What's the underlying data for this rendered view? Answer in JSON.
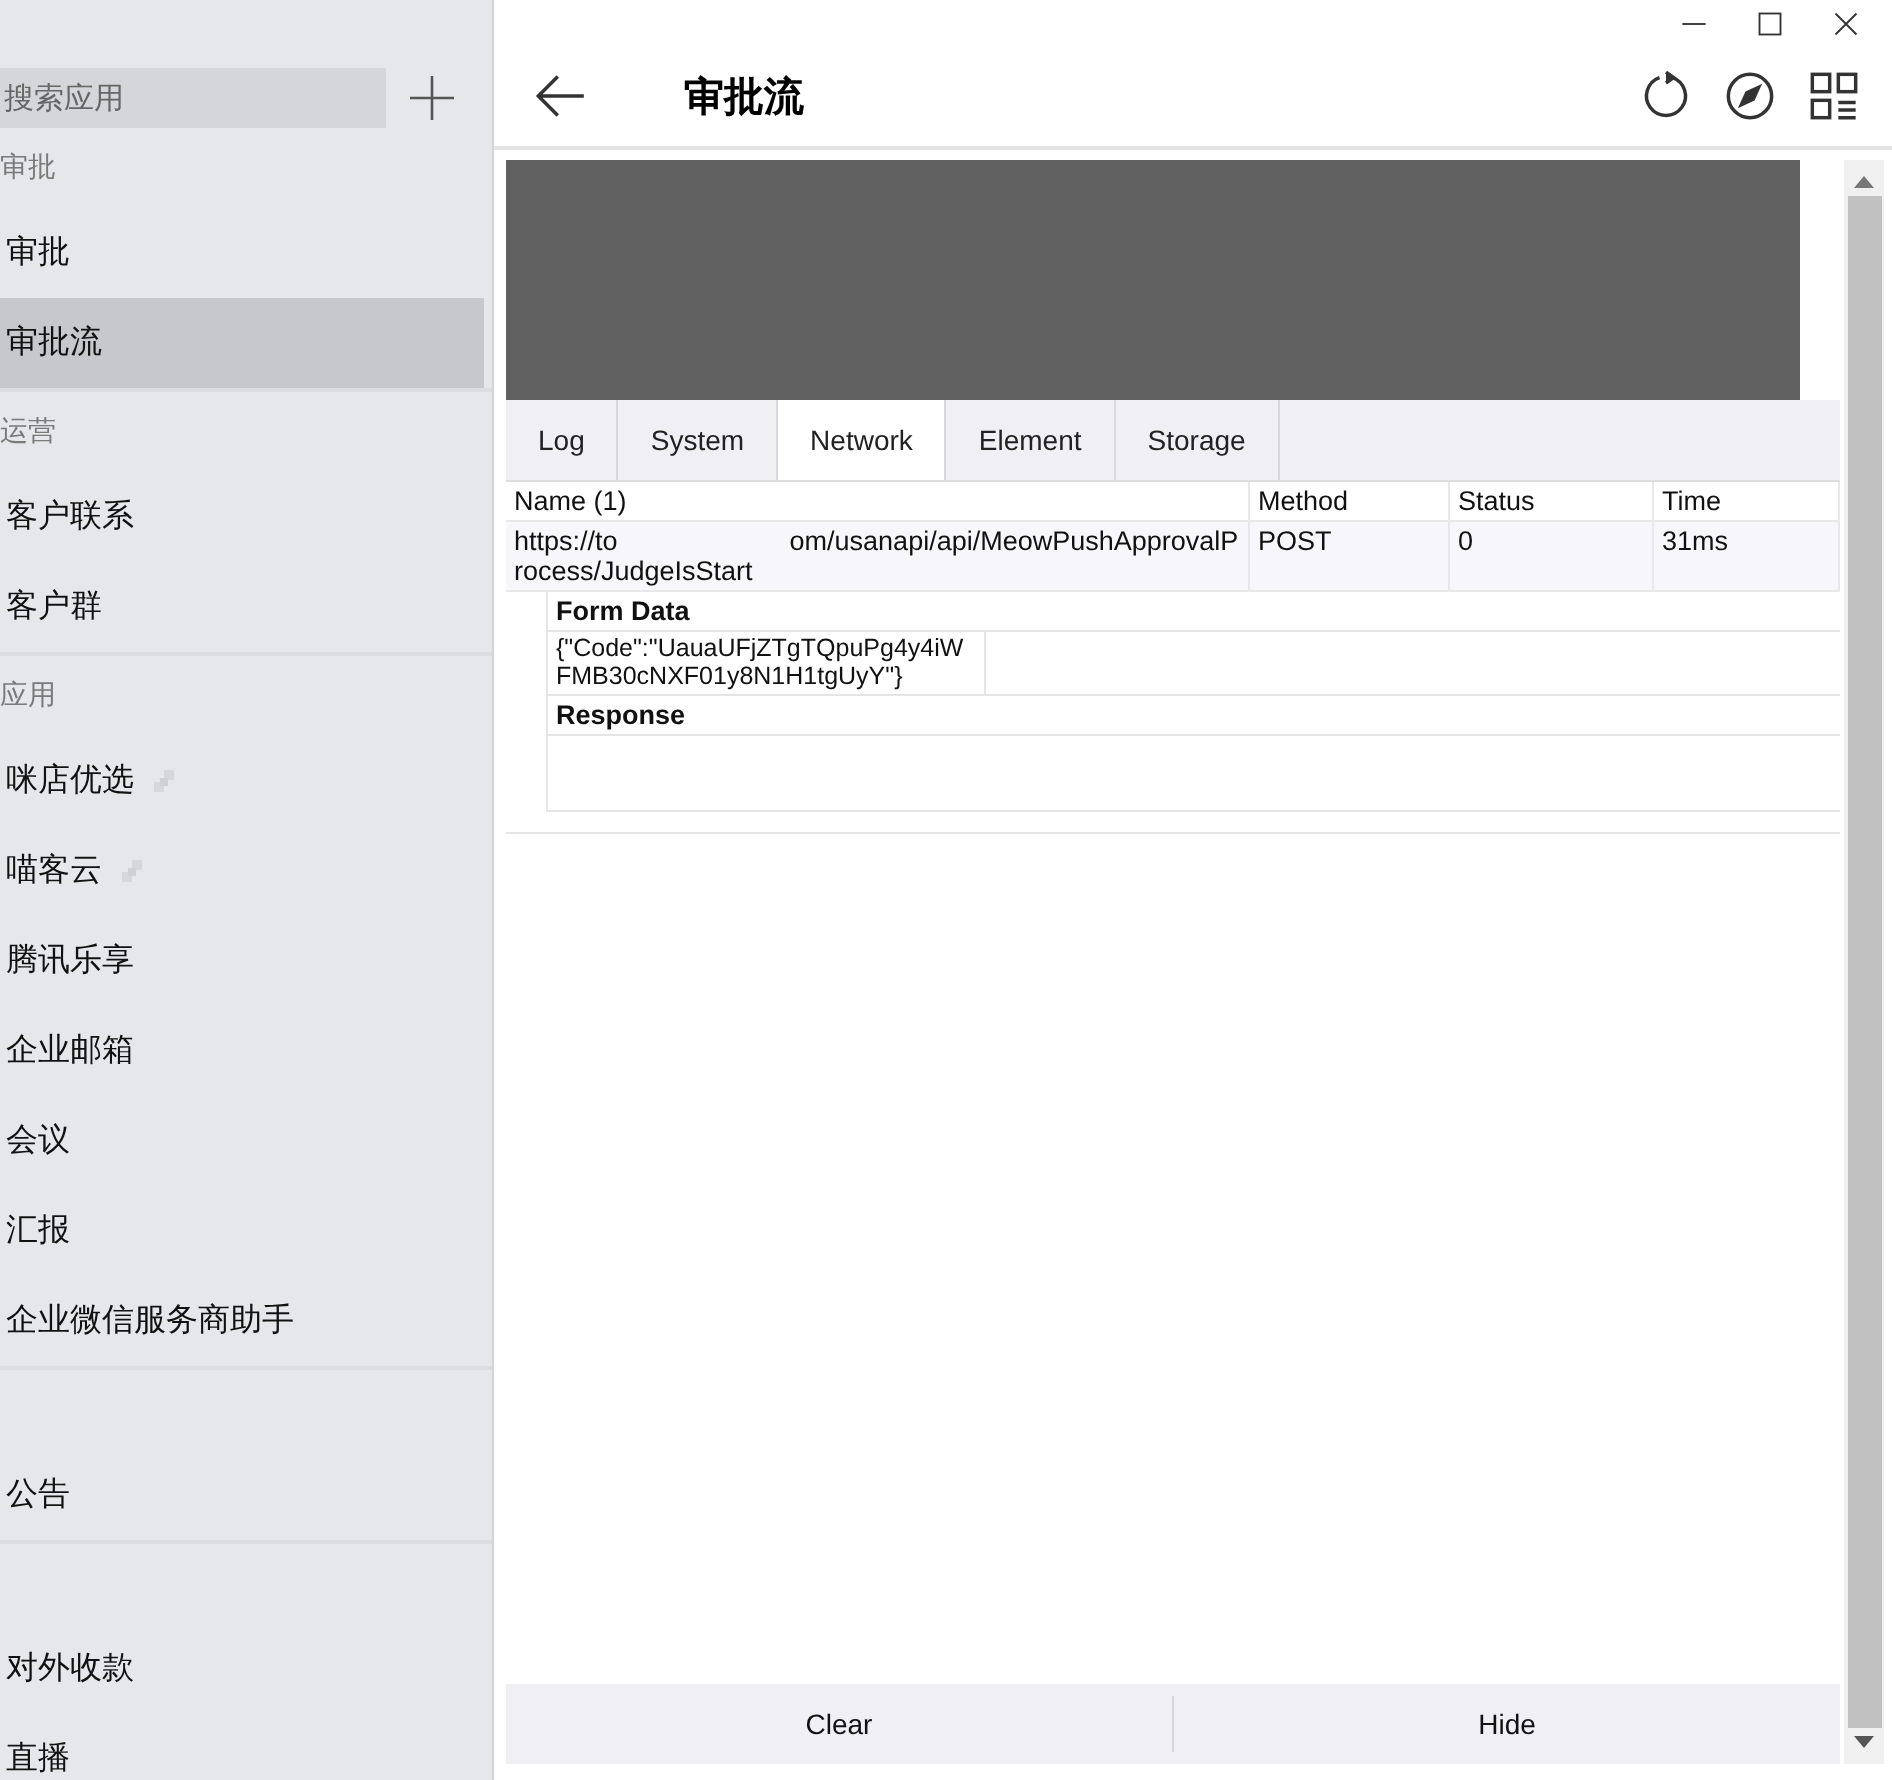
{
  "sidebar": {
    "search": {
      "placeholder": "搜索应用"
    },
    "groups": [
      {
        "label": "审批",
        "items": [
          {
            "label": "审批",
            "selected": false,
            "external": false
          },
          {
            "label": "审批流",
            "selected": true,
            "external": false
          }
        ]
      },
      {
        "label": "运营",
        "items": [
          {
            "label": "客户联系",
            "selected": false,
            "external": false
          },
          {
            "label": "客户群",
            "selected": false,
            "external": false
          }
        ]
      },
      {
        "label": "应用",
        "items": [
          {
            "label": "咪店优选",
            "selected": false,
            "external": true
          },
          {
            "label": "喵客云",
            "selected": false,
            "external": true
          },
          {
            "label": "腾讯乐享",
            "selected": false,
            "external": false
          },
          {
            "label": "企业邮箱",
            "selected": false,
            "external": false
          },
          {
            "label": "会议",
            "selected": false,
            "external": false
          },
          {
            "label": "汇报",
            "selected": false,
            "external": false
          },
          {
            "label": "企业微信服务商助手",
            "selected": false,
            "external": false
          }
        ]
      },
      {
        "items": [
          {
            "label": "公告",
            "selected": false,
            "external": false
          }
        ]
      },
      {
        "items": [
          {
            "label": "对外收款",
            "selected": false,
            "external": false
          },
          {
            "label": "直播",
            "selected": false,
            "external": false
          }
        ]
      }
    ]
  },
  "page": {
    "title": "审批流"
  },
  "console": {
    "tabs": [
      {
        "label": "Log",
        "selected": false
      },
      {
        "label": "System",
        "selected": false
      },
      {
        "label": "Network",
        "selected": true
      },
      {
        "label": "Element",
        "selected": false
      },
      {
        "label": "Storage",
        "selected": false
      }
    ],
    "columns": [
      "Name (1)",
      "Method",
      "Status",
      "Time"
    ],
    "request": {
      "url_start": "https://to",
      "url_rest": "om/usanapi/api/MeowPushApprovalProcess/JudgeIsStart",
      "method": "POST",
      "status": "0",
      "time": "31ms"
    },
    "form_data": {
      "title": "Form Data",
      "value": "{\"Code\":\"UauaUFjZTgTQpuPg4y4iWFMB30cNXF01y8N1H1tgUyY\"}"
    },
    "response": {
      "title": "Response"
    },
    "buttons": [
      "Clear",
      "Hide"
    ]
  }
}
